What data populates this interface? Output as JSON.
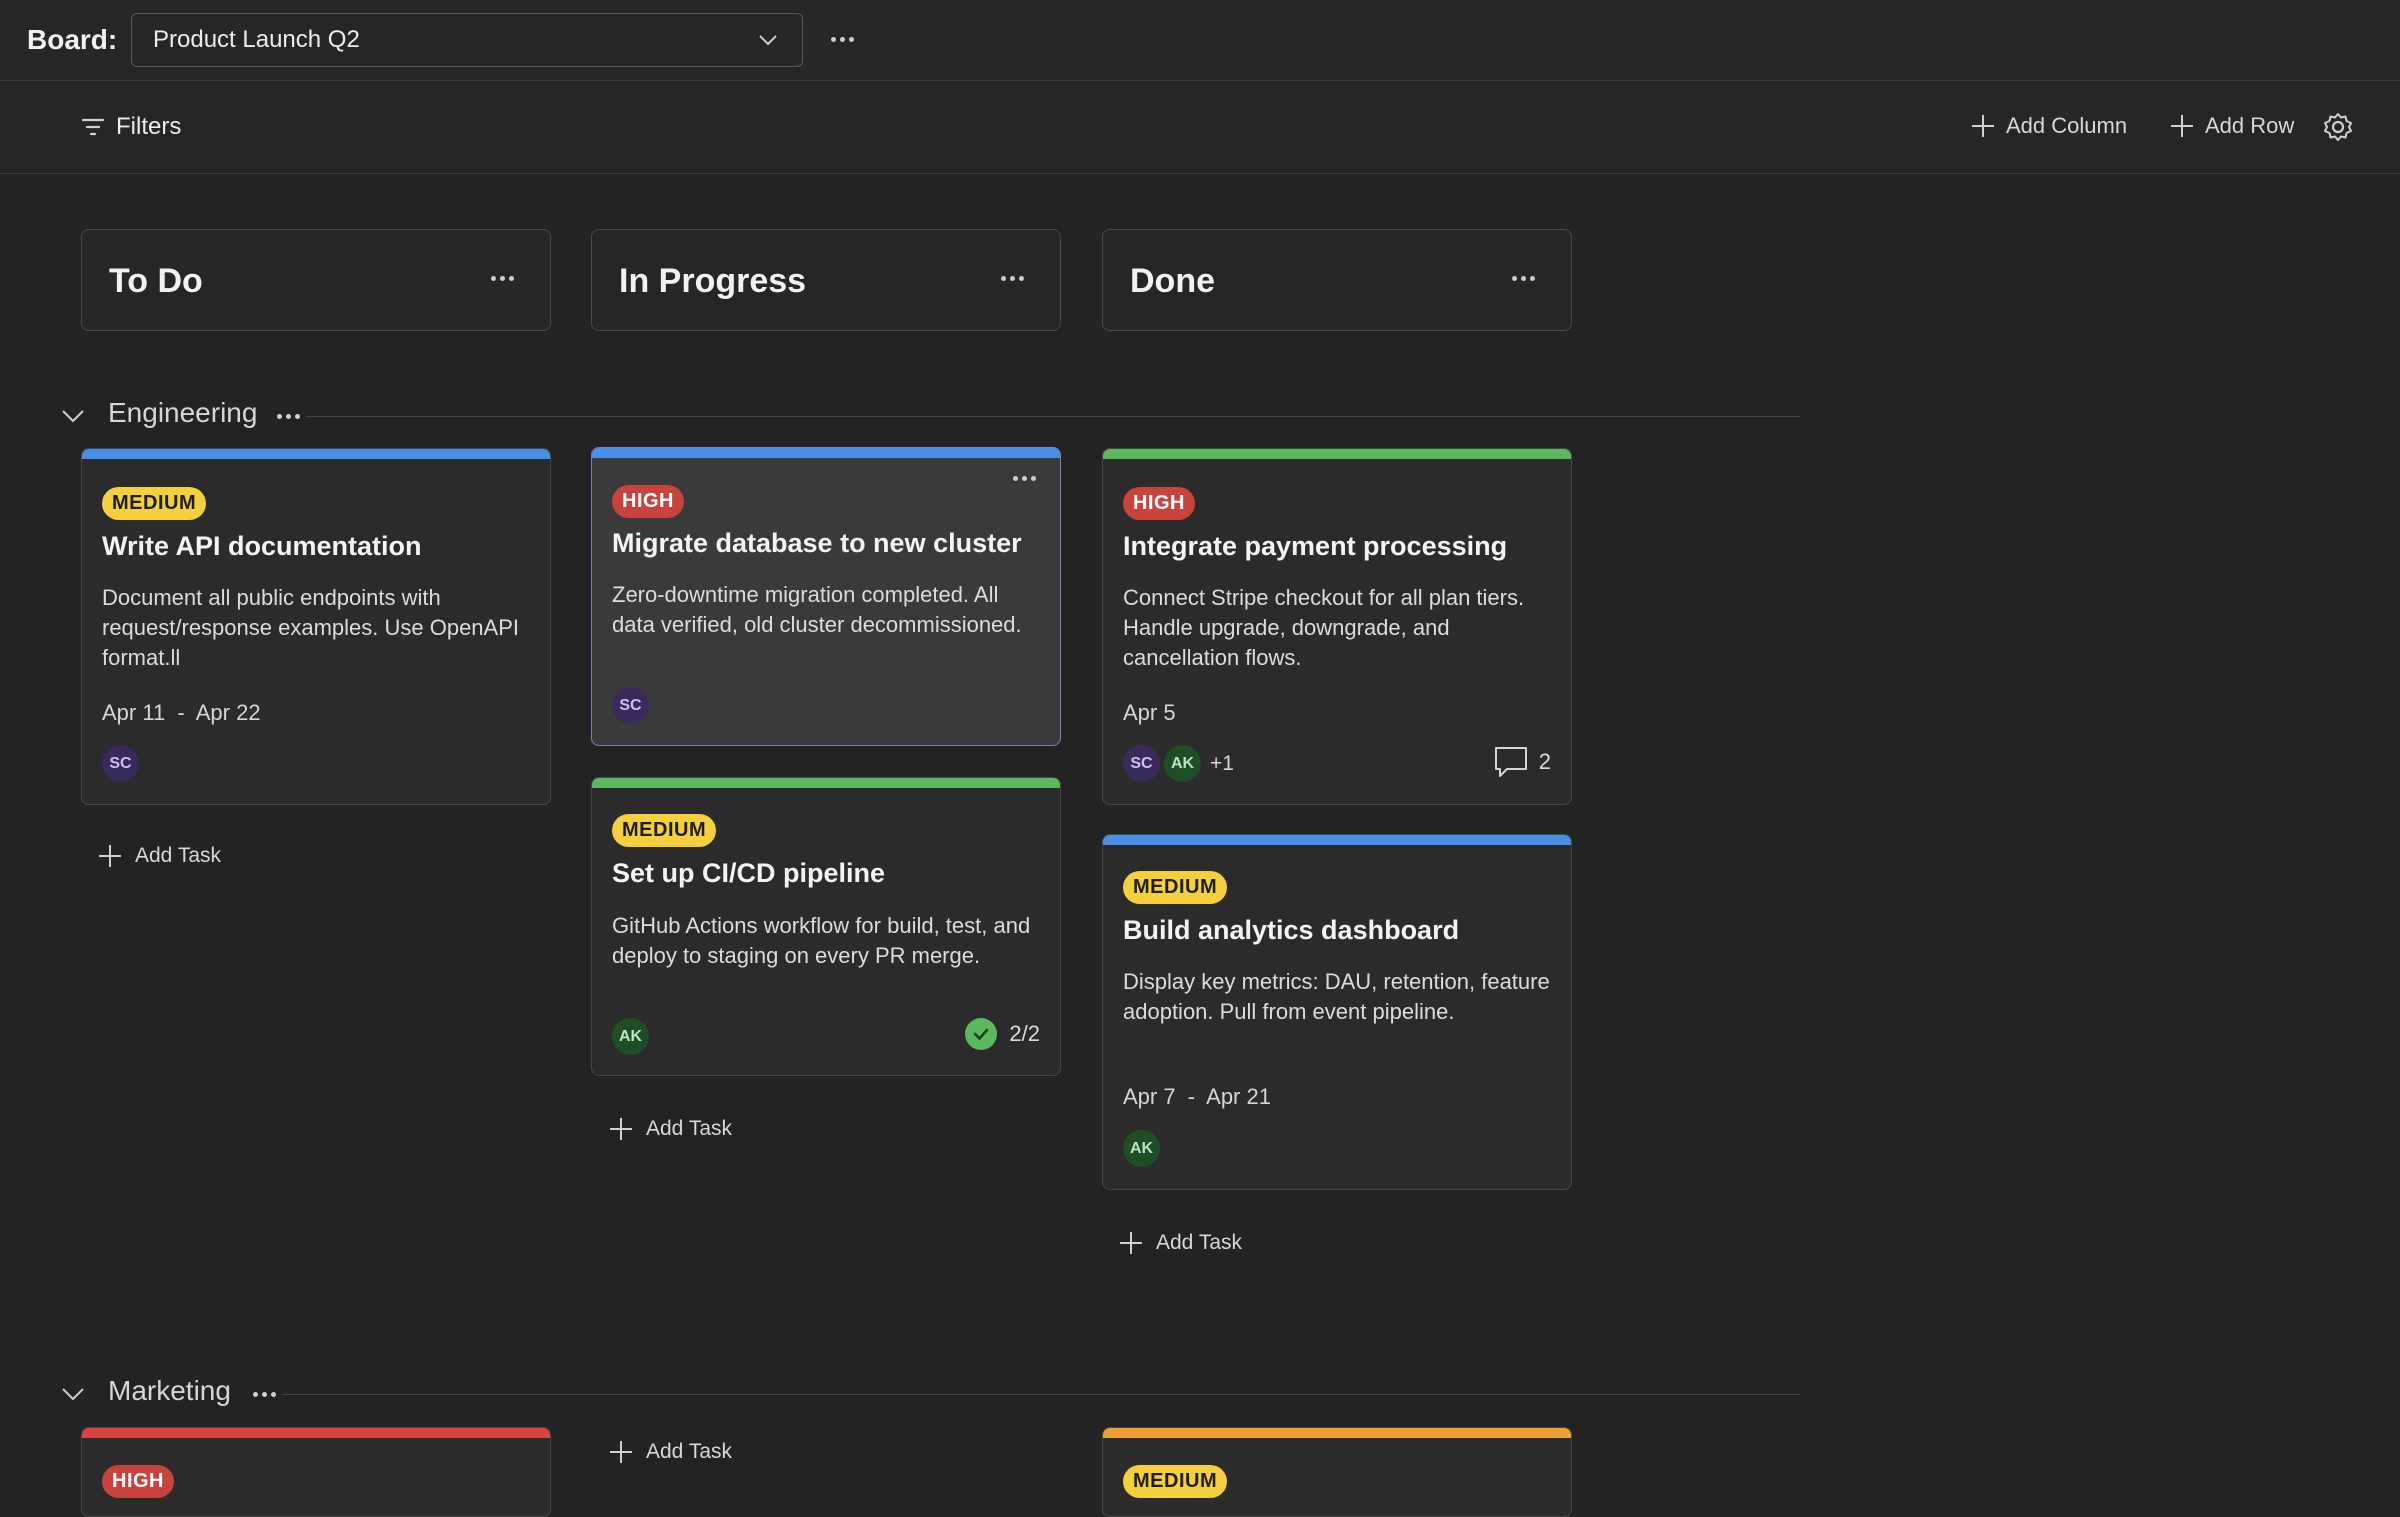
{
  "header": {
    "board_label": "Board:",
    "board_value": "Product Launch Q2"
  },
  "toolbar": {
    "filters_label": "Filters",
    "add_column_label": "Add Column",
    "add_row_label": "Add Row"
  },
  "columns": [
    {
      "title": "To Do"
    },
    {
      "title": "In Progress"
    },
    {
      "title": "Done"
    }
  ],
  "groups": [
    {
      "name": "Engineering"
    },
    {
      "name": "Marketing"
    }
  ],
  "add_task_label": "Add Task",
  "cards": {
    "api_docs": {
      "priority": "MEDIUM",
      "title": "Write API documentation",
      "description": "Document all public endpoints with request/response examples. Use OpenAPI format.ll",
      "date": "Apr 11  -  Apr 22",
      "assignees": [
        "SC"
      ],
      "bar_color": "#4a8fe7"
    },
    "migrate_db": {
      "priority": "HIGH",
      "title": "Migrate database to new cluster",
      "description": "Zero-downtime migration completed. All data verified, old cluster decommissioned.",
      "assignees": [
        "SC"
      ],
      "bar_color": "#4a8fe7"
    },
    "cicd": {
      "priority": "MEDIUM",
      "title": "Set up CI/CD pipeline",
      "description": "GitHub Actions workflow for build, test, and deploy to staging on every PR merge.",
      "assignees": [
        "AK"
      ],
      "checklist": "2/2",
      "bar_color": "#5cb85c"
    },
    "payments": {
      "priority": "HIGH",
      "title": "Integrate payment processing",
      "description": "Connect Stripe checkout for all plan tiers. Handle upgrade, downgrade, and cancellation flows.",
      "date": "Apr 5",
      "assignees": [
        "SC",
        "AK"
      ],
      "extra_assignees": "+1",
      "comments": "2",
      "bar_color": "#5cb85c"
    },
    "analytics": {
      "priority": "MEDIUM",
      "title": "Build analytics dashboard",
      "description": "Display key metrics: DAU, retention, feature adoption. Pull from event pipeline.",
      "date": "Apr 7  -  Apr 21",
      "assignees": [
        "AK"
      ],
      "bar_color": "#4a8fe7"
    },
    "mkt_todo": {
      "priority": "HIGH",
      "bar_color": "#d9433d"
    },
    "mkt_done": {
      "priority": "MEDIUM",
      "bar_color": "#f0a030"
    }
  }
}
